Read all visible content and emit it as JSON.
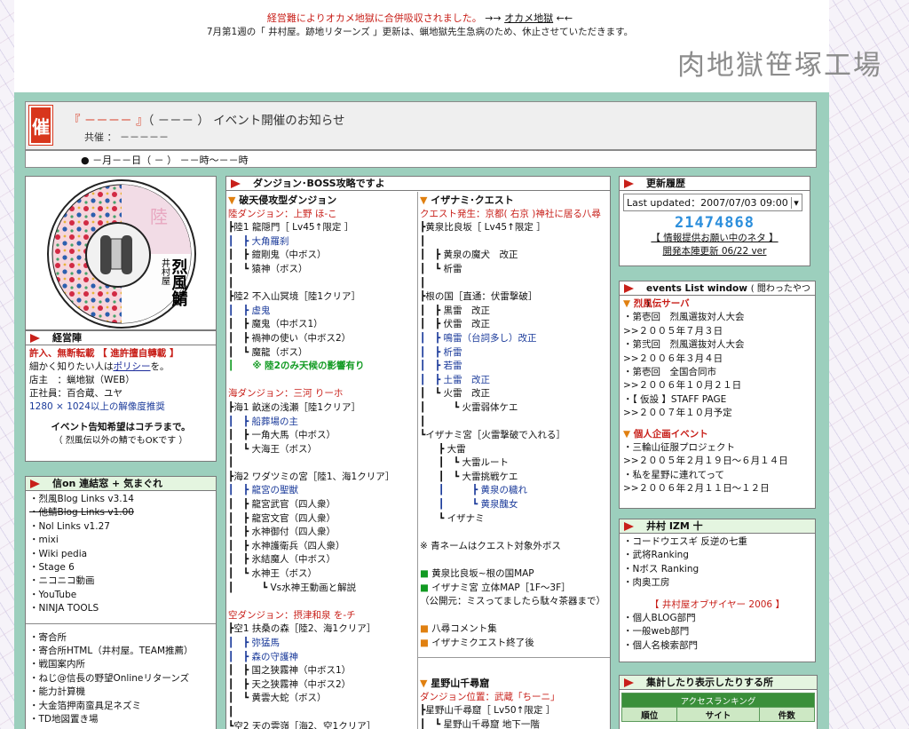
{
  "header": {
    "notice_red": "経営難によりオカメ地獄に合併吸収されました。",
    "notice_arrow_l": "→→",
    "notice_link": "オカメ地獄",
    "notice_arrow_r": "←←",
    "notice_sub": "7月第1週の「 井村屋。跡地リターンズ 」更新は、蝋地獄先生急病のため、休止させていただきます。",
    "logo_text": "肉地獄笹塚工場"
  },
  "event": {
    "icon_label": "催",
    "title_bracket": "『 －－－－ 』",
    "title_rest": "（ －－－ ） イベント開催のお知らせ",
    "sponsor": "共催 ： －－－－－",
    "date": "● －月－－日（ － ） －－時～－－時"
  },
  "emblem": {
    "chars": "陸",
    "name1": "井村屋",
    "name2": "烈風鯖"
  },
  "keiei": {
    "title": "経営陣",
    "l1": "許入、無断転載 【 進許擅自轉載 】",
    "l2": "細かく知りたい人は",
    "l2_link": "ポリシー",
    "l2_end": "を。",
    "l3": "店主　：蝋地獄（WEB）",
    "l4": "正社員：百合蔵、ユヤ",
    "l5": "1280 × 1024以上の解像度推奨",
    "l6": "イベント告知希望はコチラまで。",
    "l7": "（ 烈風伝以外の鯖でもOKです ）"
  },
  "links": {
    "title": "信on 連結窓 + 気まぐれ",
    "items1": [
      "烈風Blog Links v3.14",
      "他鯖Blog Links v1.00",
      "Nol Links v1.27",
      "mixi",
      "Wiki pedia",
      "Stage 6",
      "ニコニコ動画",
      "YouTube",
      "NINJA TOOLS"
    ],
    "items2": [
      "寄合所",
      "寄合所HTML（井村屋。TEAM推薦）",
      "戦国案内所",
      "ねじ@信長の野望Onlineリターンズ",
      "能力計算機",
      "大金箔押南蛮具足ネズミ",
      "TD地図置き場"
    ]
  },
  "dungeon": {
    "title": "ダンジョン･BOSS攻略ですよ",
    "col1": [
      {
        "t": "破天侵攻型ダンジョン",
        "c": "sect"
      },
      {
        "t": "陸ダンジョン：上野 ほ-こ",
        "c": "red"
      },
      {
        "t": "┣陸1 龍隠門［ Lv45↑限定 ］",
        "c": ""
      },
      {
        "t": "┃　┣ 大角羅刹",
        "c": "blu"
      },
      {
        "t": "┃　┣ 鎧剛鬼（中ボス）",
        "c": ""
      },
      {
        "t": "┃　┗ 猿神（ボス）",
        "c": ""
      },
      {
        "t": "┃",
        "c": ""
      },
      {
        "t": "┣陸2 不入山冥境［陸1クリア］",
        "c": ""
      },
      {
        "t": "┃　┣ 虚鬼",
        "c": "blu"
      },
      {
        "t": "┃　┣ 魔鬼（中ボス1）",
        "c": ""
      },
      {
        "t": "┃　┣ 禍神の使い（中ボス2）",
        "c": ""
      },
      {
        "t": "┃　┗ 魔龍（ボス）",
        "c": ""
      },
      {
        "t": "┃　　※ 陸2のみ天候の影響有り",
        "c": "grn"
      },
      {
        "t": "",
        "c": ""
      },
      {
        "t": "海ダンジョン：三河 りーホ",
        "c": "red"
      },
      {
        "t": "┣海1 畝迷の浅瀬［陸1クリア］",
        "c": ""
      },
      {
        "t": "┃　┣ 船葬場の主",
        "c": "blu"
      },
      {
        "t": "┃　┣ 一角大馬（中ボス）",
        "c": ""
      },
      {
        "t": "┃　┗ 大海王（ボス）",
        "c": ""
      },
      {
        "t": "┃",
        "c": ""
      },
      {
        "t": "┣海2 ワダツミの宮［陸1、海1クリア］",
        "c": ""
      },
      {
        "t": "┃　┣ 龍宮の聖獣",
        "c": "blu"
      },
      {
        "t": "┃　┣ 龍宮武官（四人衆）",
        "c": ""
      },
      {
        "t": "┃　┣ 龍宮文官（四人衆）",
        "c": ""
      },
      {
        "t": "┃　┣ 水神御付（四人衆）",
        "c": ""
      },
      {
        "t": "┃　┣ 水神護衛兵（四人衆）",
        "c": ""
      },
      {
        "t": "┃　┣ 氷結魔人（中ボス）",
        "c": ""
      },
      {
        "t": "┃　┗ 水神王（ボス）",
        "c": ""
      },
      {
        "t": "┃　　　┗ Vs水神王動画と解説",
        "c": ""
      },
      {
        "t": "",
        "c": ""
      },
      {
        "t": "空ダンジョン：摂津和泉 を-チ",
        "c": "red"
      },
      {
        "t": "┣空1 扶桑の森［陸2、海1クリア］",
        "c": ""
      },
      {
        "t": "┃　┣ 弥猛馬",
        "c": "blu"
      },
      {
        "t": "┃　┣ 森の守護神",
        "c": "blu"
      },
      {
        "t": "┃　┣ 国之狭霧神（中ボス1）",
        "c": ""
      },
      {
        "t": "┃　┣ 天之狭霧神（中ボス2）",
        "c": ""
      },
      {
        "t": "┃　┗ 黄雲大蛇（ボス）",
        "c": ""
      },
      {
        "t": "┃",
        "c": ""
      },
      {
        "t": "┗空2 天の雲嶺［海2、空1クリア］",
        "c": ""
      }
    ],
    "col2": [
      {
        "t": "イザナミ･クエスト",
        "c": "sect"
      },
      {
        "t": "クエスト発生：京都( 右京 )神社に居る八尋",
        "c": "red"
      },
      {
        "t": "┣黄泉比良坂［ Lv45↑限定 ］",
        "c": ""
      },
      {
        "t": "┃",
        "c": ""
      },
      {
        "t": "┃　┣ 黄泉の魔犬　改正",
        "c": ""
      },
      {
        "t": "┃　┗ 析雷",
        "c": ""
      },
      {
        "t": "┃",
        "c": ""
      },
      {
        "t": "┣根の国［直通：伏雷撃破］",
        "c": ""
      },
      {
        "t": "┃　┣ 黒雷　改正",
        "c": ""
      },
      {
        "t": "┃　┣ 伏雷　改正",
        "c": ""
      },
      {
        "t": "┃　┣ 鳴雷（台詞多し）改正",
        "c": "blu"
      },
      {
        "t": "┃　┣ 析雷",
        "c": "blu"
      },
      {
        "t": "┃　┣ 若雷",
        "c": "blu"
      },
      {
        "t": "┃　┣ 土雷　改正",
        "c": "blu"
      },
      {
        "t": "┃　┗ 火雷　改正",
        "c": ""
      },
      {
        "t": "┃　　　┗ 火雷弱体ケエ",
        "c": ""
      },
      {
        "t": "┃",
        "c": ""
      },
      {
        "t": "┗イザナミ宮［火雷撃破で入れる］",
        "c": ""
      },
      {
        "t": "　　┣ 大雷",
        "c": ""
      },
      {
        "t": "　　┃　┗ 大雷ルート",
        "c": ""
      },
      {
        "t": "　　┃　┗ 大雷挑戦ケエ",
        "c": ""
      },
      {
        "t": "　　┃　　　┣ 黄泉の穢れ",
        "c": "blu"
      },
      {
        "t": "　　┃　　　┗ 黄泉醜女",
        "c": "blu"
      },
      {
        "t": "　　┗ イザナミ",
        "c": ""
      },
      {
        "t": "",
        "c": ""
      },
      {
        "t": "※ 青ネームはクエスト対象外ボス",
        "c": ""
      },
      {
        "t": "",
        "c": ""
      },
      {
        "t": "■ 黄泉比良坂~根の国MAP",
        "c": "gsq"
      },
      {
        "t": "■ イザナミ宮 立体MAP［1F～3F］",
        "c": "gsq"
      },
      {
        "t": "（公開元：ミスってましたら駄々茶器まで）",
        "c": ""
      },
      {
        "t": "",
        "c": ""
      },
      {
        "t": "■ 八尋コメント集",
        "c": "osq"
      },
      {
        "t": "■ イザナミクエスト終了後",
        "c": "osq"
      }
    ],
    "col2b": [
      {
        "t": "星野山千尋窟",
        "c": "sect"
      },
      {
        "t": "ダンジョン位置：武蔵「ちーニ」",
        "c": "red"
      },
      {
        "t": "┣星野山千尋窟［ Lv50↑限定 ］",
        "c": ""
      },
      {
        "t": "┃　┗ 星野山千尋窟 地下一階",
        "c": ""
      }
    ]
  },
  "update": {
    "title": "更新履歴",
    "last_updated": "Last updated：2007/07/03 09:00",
    "counter": "21474868",
    "info_link": "【 情報提供お願い中のネタ 】",
    "renew_link": "開発本陣更新 06/22 ver"
  },
  "events_list": {
    "title": "events List window",
    "title_sub": "( 閲わったやつ )",
    "sec1": "烈風伝サーバ",
    "items1": [
      "・第壱回　烈風選抜対人大会",
      ">>２００５年７月３日",
      "・第弐回　烈風選抜対人大会",
      ">>２００６年３月４日",
      "・第壱回　全国合同市",
      ">>２００６年１０月２１日",
      "・【 仮設 】STAFF PAGE",
      ">>２００７年１０月予定"
    ],
    "sec2": "個人企画イベント",
    "items2": [
      "・三輪山征服プロジェクト",
      ">>２００５年２月１９日～６月１４日",
      "・私を星野に連れてって",
      ">>２００６年２月１１日～１２日"
    ]
  },
  "izm": {
    "title": "井村 IZM 十",
    "items1": [
      "・コードウエスギ 反逆の七重",
      "・武将Ranking",
      "・Nボス Ranking",
      "・肉奥工房"
    ],
    "award": "【 井村屋オブザイヤー 2006 】",
    "items2": [
      "・個人BLOG部門",
      "・一般web部門",
      "・個人名検索部門"
    ]
  },
  "stats": {
    "title": "集計したり表示したりする所",
    "ranking": "アクセスランキング",
    "headers": [
      "順位",
      "サイト",
      "件数"
    ]
  }
}
